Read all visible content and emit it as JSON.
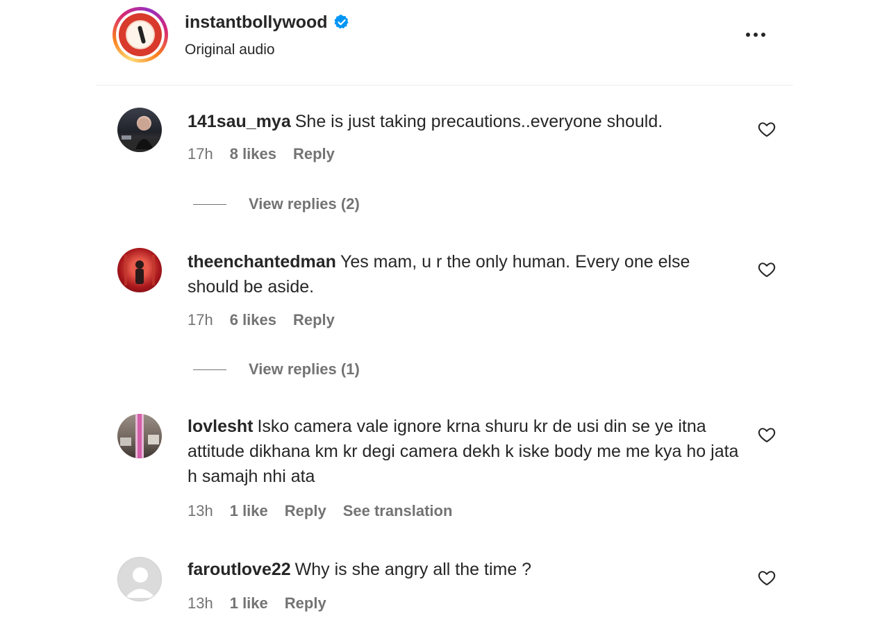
{
  "post": {
    "username": "instantbollywood",
    "verified": true,
    "subtitle": "Original audio"
  },
  "comments": [
    {
      "username": "141sau_mya",
      "text": "She is just taking precautions..everyone should.",
      "time": "17h",
      "likes": "8 likes",
      "reply_label": "Reply",
      "view_replies": "View replies (2)"
    },
    {
      "username": "theenchantedman",
      "text": "Yes mam, u r the only human. Every one else should be aside.",
      "time": "17h",
      "likes": "6 likes",
      "reply_label": "Reply",
      "view_replies": "View replies (1)"
    },
    {
      "username": "lovlesht",
      "text": "Isko camera vale ignore krna shuru kr de usi din se ye itna attitude dikhana km kr degi camera dekh k iske body me me kya ho jata h samajh nhi ata",
      "time": "13h",
      "likes": "1 like",
      "reply_label": "Reply",
      "see_translation": "See translation"
    },
    {
      "username": "faroutlove22",
      "text": "Why is she angry all the time ?",
      "time": "13h",
      "likes": "1 like",
      "reply_label": "Reply"
    }
  ],
  "icons": {
    "verified": "verified-badge-icon",
    "more": "more-options-icon",
    "like": "heart-outline-icon"
  },
  "colors": {
    "text": "#262626",
    "secondary": "#737373",
    "verified": "#0095f6",
    "divider": "#ececec"
  }
}
